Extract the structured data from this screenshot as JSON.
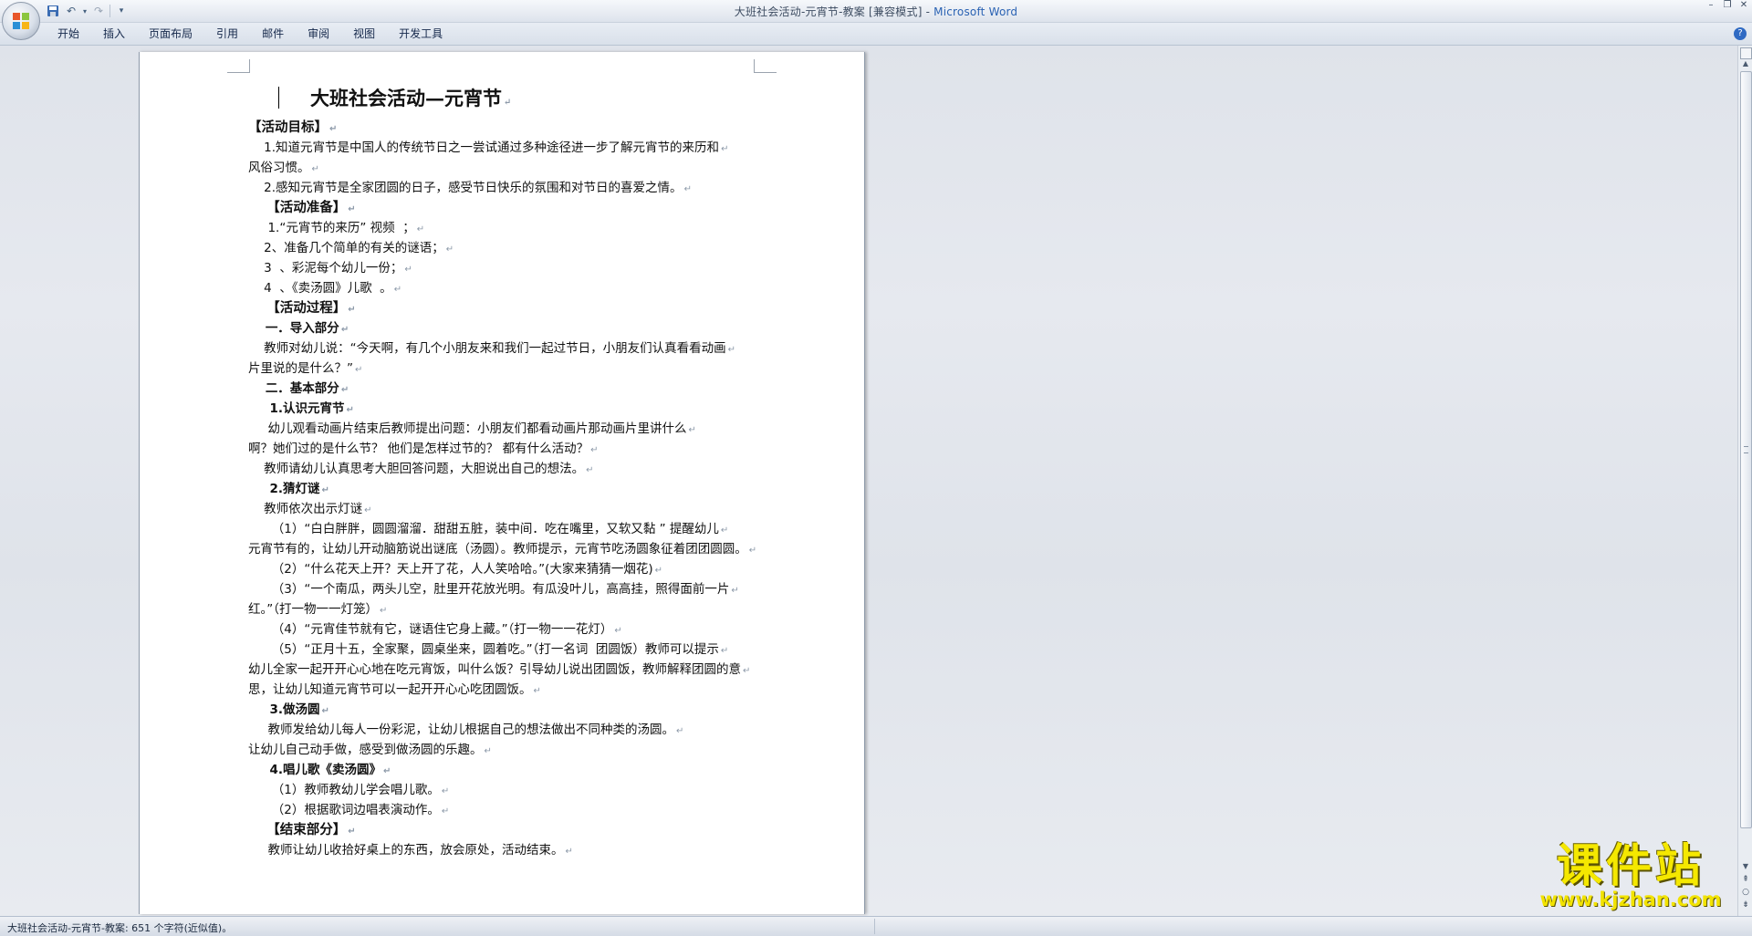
{
  "window": {
    "title": "大班社会活动-元宵节-教案 [兼容模式]",
    "separator": " - ",
    "app": "Microsoft Word"
  },
  "ribbon": {
    "tabs": [
      "开始",
      "插入",
      "页面布局",
      "引用",
      "邮件",
      "审阅",
      "视图",
      "开发工具"
    ]
  },
  "document": {
    "title": "大班社会活动—元宵节",
    "lines": [
      {
        "text": "【活动目标】",
        "style": "h"
      },
      {
        "text": "    1.知道元宵节是中国人的传统节日之一尝试通过多种途径进一步了解元宵节的来历和",
        "style": ""
      },
      {
        "text": "风俗习惯。",
        "style": ""
      },
      {
        "text": "    2.感知元宵节是全家团圆的日子，感受节日快乐的氛围和对节日的喜爱之情。",
        "style": ""
      },
      {
        "text": "    【活动准备】",
        "style": "h"
      },
      {
        "text": "     1.“元宵节的来历” 视频  ；",
        "style": ""
      },
      {
        "text": "    2、准备几个简单的有关的谜语；",
        "style": ""
      },
      {
        "text": "    3  、彩泥每个幼儿一份；",
        "style": ""
      },
      {
        "text": "    4  、《卖汤圆》儿歌  。",
        "style": ""
      },
      {
        "text": "    【活动过程】",
        "style": "h"
      },
      {
        "text": "    一．导入部分",
        "style": "b"
      },
      {
        "text": "    教师对幼儿说：“今天啊，有几个小朋友来和我们一起过节日，小朋友们认真看看动画",
        "style": ""
      },
      {
        "text": "片里说的是什么？”",
        "style": ""
      },
      {
        "text": "    二．基本部分",
        "style": "b"
      },
      {
        "text": "     1.认识元宵节",
        "style": "b"
      },
      {
        "text": "     幼儿观看动画片结束后教师提出问题：小朋友们都看动画片那动画片里讲什么",
        "style": ""
      },
      {
        "text": "啊？她们过的是什么节？ 他们是怎样过节的？ 都有什么活动？",
        "style": ""
      },
      {
        "text": "    教师请幼儿认真思考大胆回答问题，大胆说出自己的想法。",
        "style": ""
      },
      {
        "text": "     2.猜灯谜",
        "style": "b"
      },
      {
        "text": "    教师依次出示灯谜",
        "style": ""
      },
      {
        "text": "      （1）“白白胖胖，圆圆溜溜．甜甜五脏，装中间．吃在嘴里，又软又黏 ” 提醒幼儿",
        "style": ""
      },
      {
        "text": "元宵节有的，让幼儿开动脑筋说出谜底（汤圆）。教师提示，元宵节吃汤圆象征着团团圆圆。",
        "style": ""
      },
      {
        "text": "      （2）“什么花天上开？天上开了花，人人笑哈哈。”(大家来猜猜一烟花)",
        "style": ""
      },
      {
        "text": "      （3）“一个南瓜，两头儿空，肚里开花放光明。有瓜没叶儿，高高挂，照得面前一片",
        "style": ""
      },
      {
        "text": "红。”（打一物一一灯笼）",
        "style": ""
      },
      {
        "text": "      （4）“元宵佳节就有它，谜语住它身上藏。”（打一物一一花灯）",
        "style": ""
      },
      {
        "text": "      （5）“正月十五，全家聚，圆桌坐来，圆着吃。”（打一名词  团圆饭）教师可以提示",
        "style": ""
      },
      {
        "text": "幼儿全家一起开开心心地在吃元宵饭，叫什么饭？引导幼儿说出团圆饭，教师解释团圆的意",
        "style": ""
      },
      {
        "text": "思，让幼儿知道元宵节可以一起开开心心吃团圆饭。",
        "style": ""
      },
      {
        "text": "     3.做汤圆",
        "style": "b"
      },
      {
        "text": "     教师发给幼儿每人一份彩泥，让幼儿根据自己的想法做出不同种类的汤圆。",
        "style": ""
      },
      {
        "text": "让幼儿自己动手做，感受到做汤圆的乐趣。",
        "style": ""
      },
      {
        "text": "     4.唱儿歌《卖汤圆》",
        "style": "b"
      },
      {
        "text": "      （1）教师教幼儿学会唱儿歌。",
        "style": ""
      },
      {
        "text": "      （2）根据歌词边唱表演动作。",
        "style": ""
      },
      {
        "text": "    【结束部分】",
        "style": "h"
      },
      {
        "text": "     教师让幼儿收拾好桌上的东西，放会原处，活动结束。",
        "style": ""
      }
    ]
  },
  "status": {
    "text": "大班社会活动-元宵节-教案: 651 个字符(近似值)。"
  },
  "watermark": {
    "main": "课件站",
    "sub": "www.kjzhan.com"
  },
  "colors": {
    "title_brand": "#2a62b3",
    "watermark": "#f5e800",
    "workspace": "#dfe3ea"
  }
}
